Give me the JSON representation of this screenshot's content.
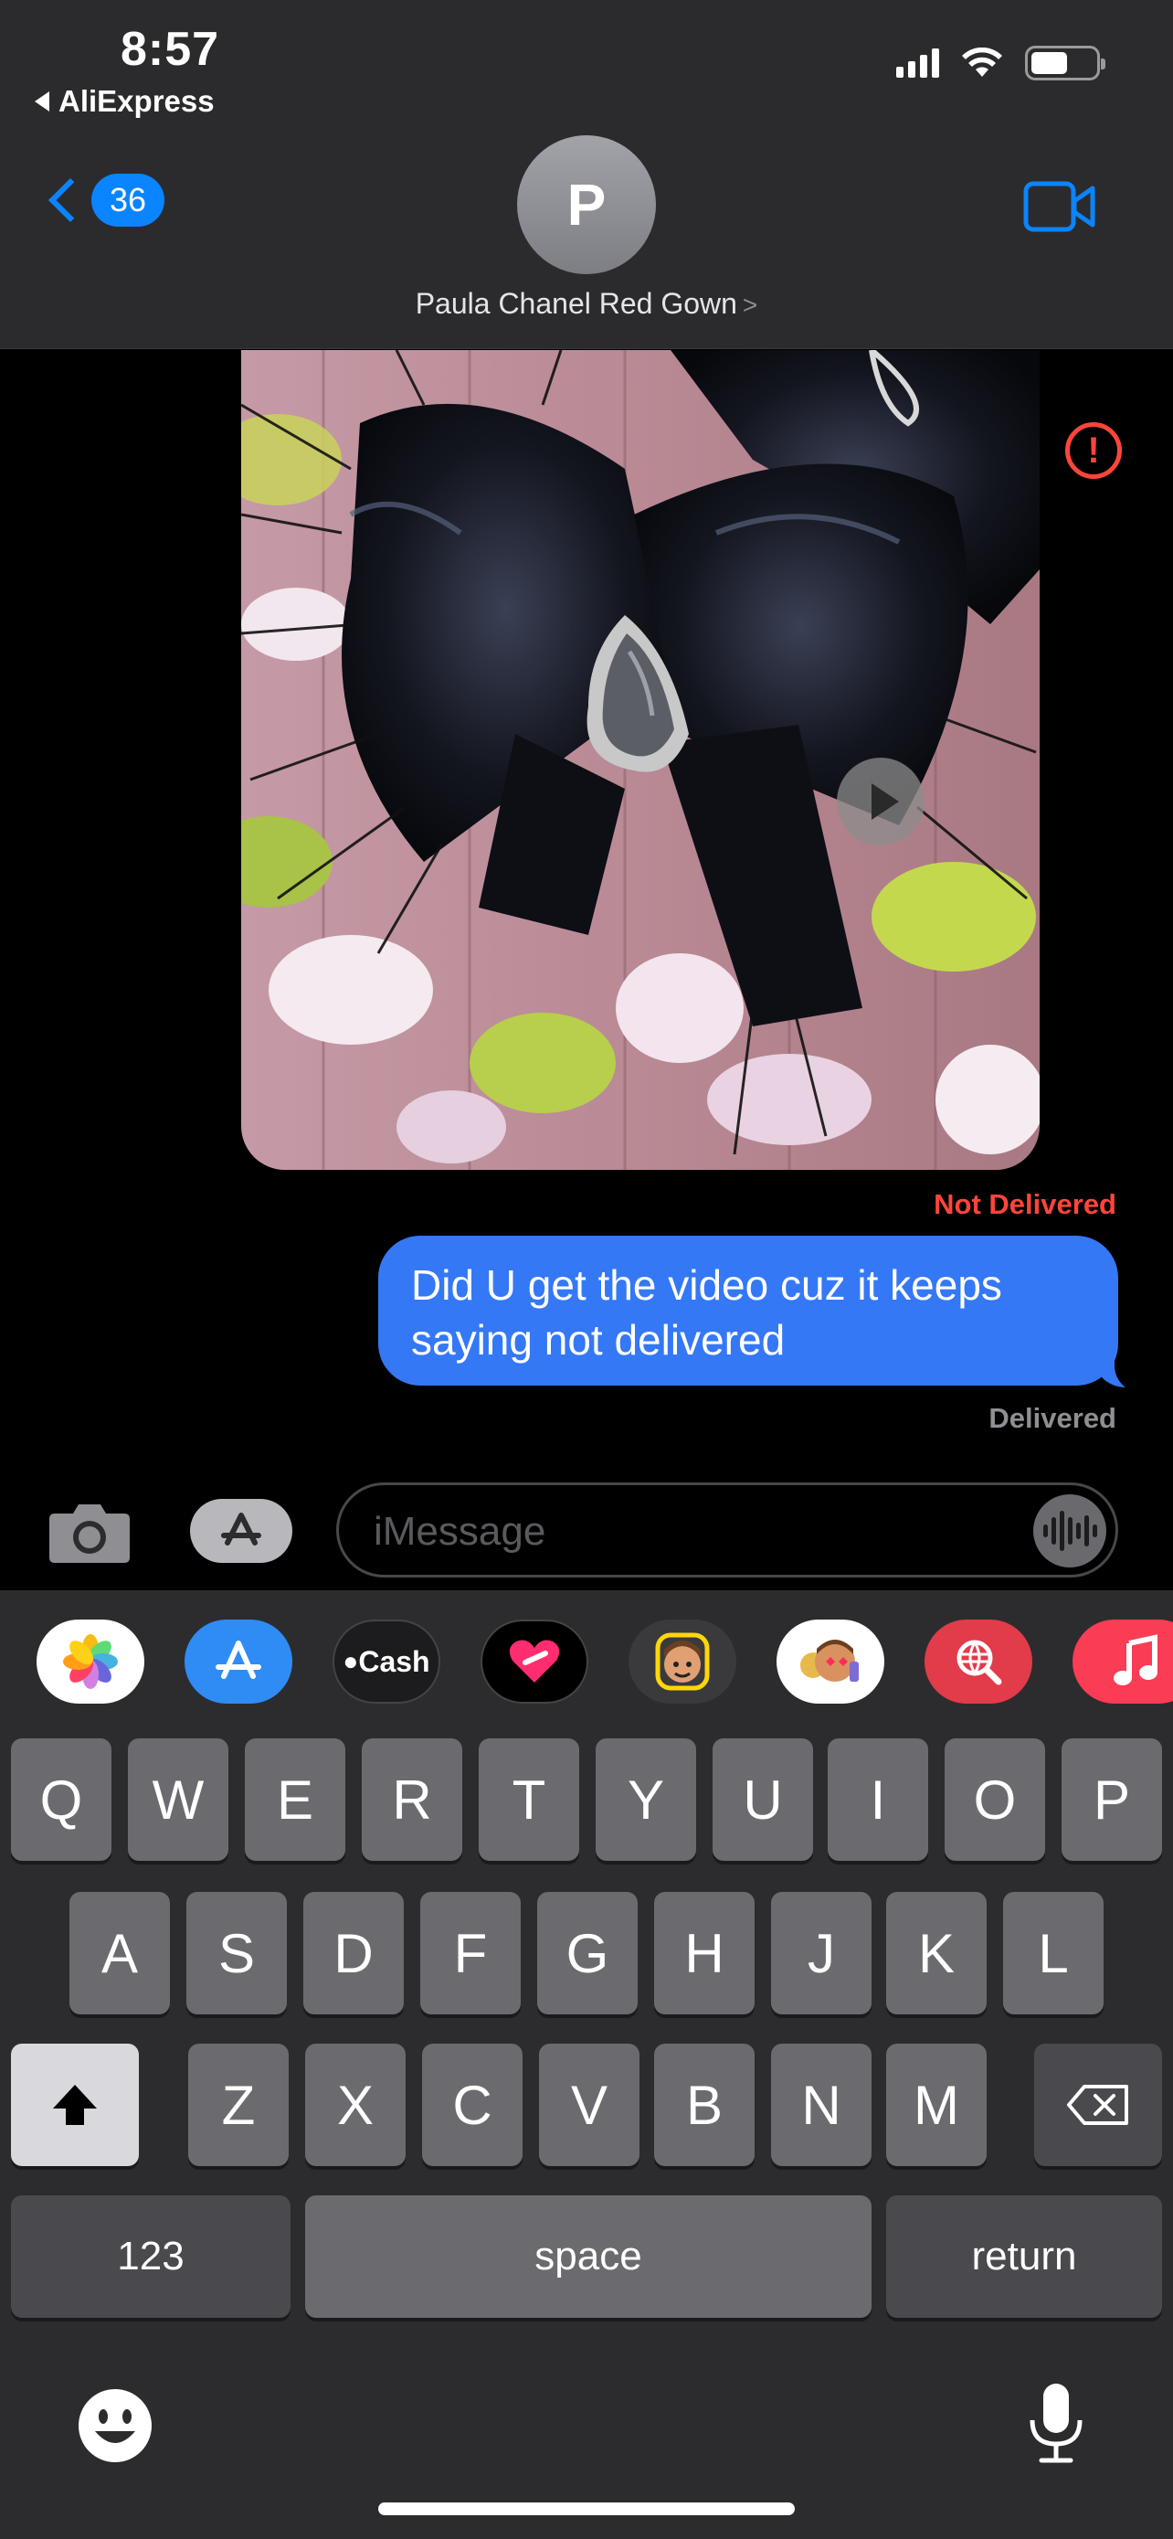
{
  "status_bar": {
    "time": "8:57",
    "back_app": "AliExpress"
  },
  "header": {
    "unread_count": "36",
    "contact_initial": "P",
    "contact_name": "Paula Chanel Red Gown",
    "chevron": ">"
  },
  "conversation": {
    "error_icon": "!",
    "not_delivered": "Not Delivered",
    "message_text": "Did U get the video cuz it keeps saying not delivered",
    "delivered": "Delivered"
  },
  "input": {
    "placeholder": "iMessage"
  },
  "app_drawer": {
    "apps": [
      "Photos",
      "App Store",
      "Cash",
      "Digital Touch",
      "Memoji",
      "Memoji Stickers",
      "Search",
      "Music"
    ],
    "cash_label": "Cash"
  },
  "keyboard": {
    "row1": [
      "Q",
      "W",
      "E",
      "R",
      "T",
      "Y",
      "U",
      "I",
      "O",
      "P"
    ],
    "row2": [
      "A",
      "S",
      "D",
      "F",
      "G",
      "H",
      "J",
      "K",
      "L"
    ],
    "row3": [
      "Z",
      "X",
      "C",
      "V",
      "B",
      "N",
      "M"
    ],
    "numbers_label": "123",
    "space_label": "space",
    "return_label": "return"
  },
  "colors": {
    "accent": "#0a84ff",
    "bubble": "#3478f6",
    "error": "#ff453a"
  }
}
